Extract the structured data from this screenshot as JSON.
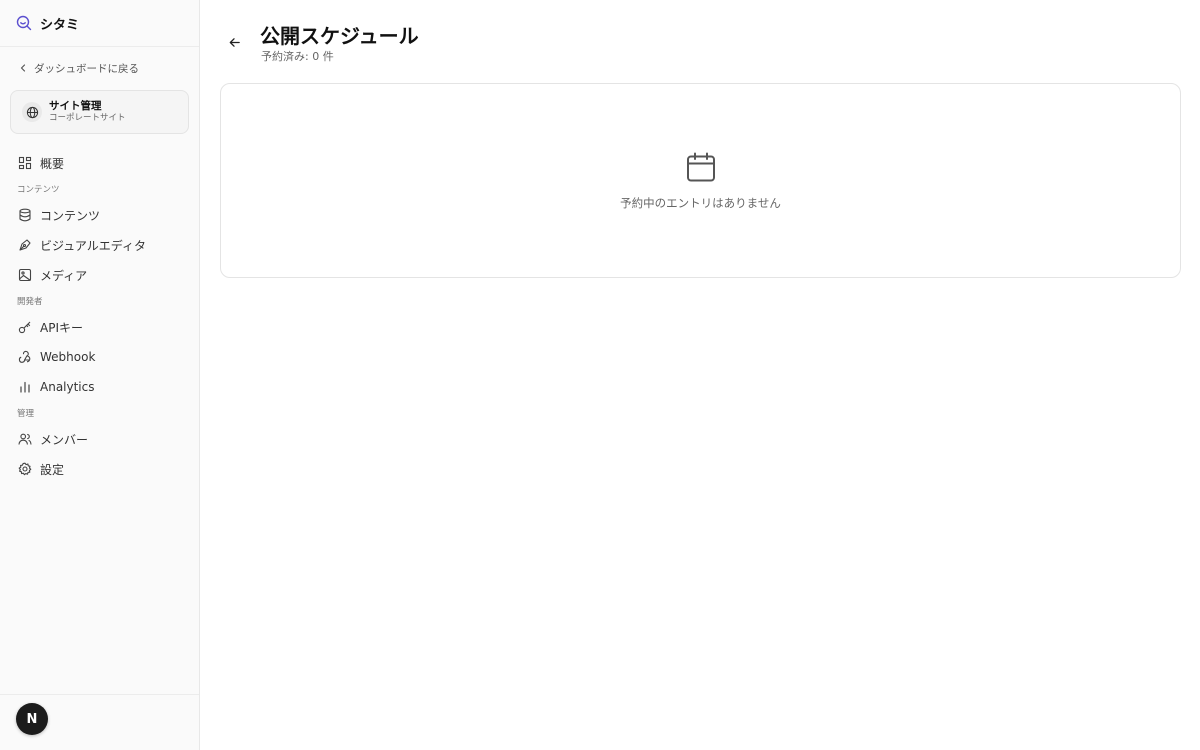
{
  "app": {
    "name": "シタミ"
  },
  "sidebar": {
    "back_label": "ダッシュボードに戻る",
    "site_card": {
      "title": "サイト管理",
      "subtitle": "コーポレートサイト"
    },
    "overview_label": "概要",
    "sections": {
      "content": "コンテンツ",
      "developer": "開発者",
      "management": "管理"
    },
    "items": {
      "content": "コンテンツ",
      "visual_editor": "ビジュアルエディタ",
      "media": "メディア",
      "api_keys": "APIキー",
      "webhook": "Webhook",
      "analytics": "Analytics",
      "members": "メンバー",
      "settings": "設定"
    },
    "avatar_initial": "N"
  },
  "main": {
    "title": "公開スケジュール",
    "subtitle": "予約済み: 0 件",
    "empty_message": "予約中のエントリはありません"
  },
  "icons": {
    "brand": "search-smile-icon",
    "back": "chevron-left-icon",
    "globe": "globe-icon",
    "overview": "grid-icon",
    "content": "database-icon",
    "visual_editor": "pen-tool-icon",
    "media": "image-icon",
    "api_keys": "key-icon",
    "webhook": "webhook-icon",
    "analytics": "bar-chart-icon",
    "members": "users-icon",
    "settings": "gear-icon",
    "page_back": "arrow-left-icon",
    "empty": "calendar-icon"
  },
  "colors": {
    "brand_accent": "#5b4fcf",
    "sidebar_bg": "#fafafa",
    "border": "#e4e4e4"
  }
}
